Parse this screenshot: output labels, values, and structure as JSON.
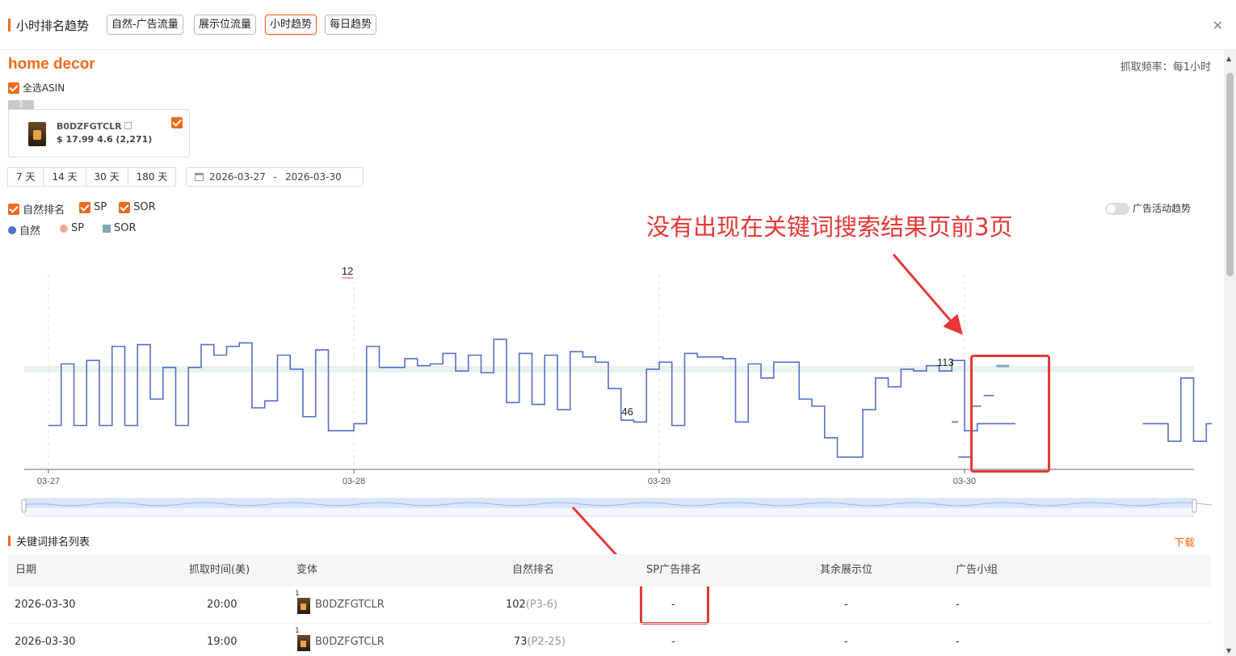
{
  "header": {
    "title": "小时排名趋势",
    "tabs": [
      {
        "label": "自然-广告流量",
        "active": false
      },
      {
        "label": "展示位流量",
        "active": false
      },
      {
        "label": "小时趋势",
        "active": true
      },
      {
        "label": "每日趋势",
        "active": false
      }
    ],
    "close_icon": "close-icon"
  },
  "keyword": "home decor",
  "frequency": "抓取频率：每1小时",
  "select_all_label": "全选ASIN",
  "asin_card": {
    "index": "1",
    "asin": "B0DZFGTCLR",
    "price_rating": "$ 17.99 4.6 (2,271)",
    "checked": true
  },
  "range_buttons": [
    "7 天",
    "14 天",
    "30 天",
    "180 天"
  ],
  "date_range": {
    "start": "2026-03-27",
    "separator": "-",
    "end": "2026-03-30"
  },
  "series_checkboxes": [
    "自然排名",
    "SP",
    "SOR"
  ],
  "legend": [
    {
      "label": "自然",
      "color": "#5470c6",
      "shape": "circle"
    },
    {
      "label": "SP",
      "color": "#f4a89a",
      "shape": "circle"
    },
    {
      "label": "SOR",
      "color": "#7fa8b8",
      "shape": "square"
    }
  ],
  "ad_trend_toggle": {
    "label": "广告活动趋势",
    "on": false
  },
  "annotation_text": "没有出现在关键词搜索结果页前3页",
  "chart_data": {
    "type": "line",
    "step": true,
    "x_ticks": [
      "03-27",
      "03-28",
      "03-29",
      "03-30"
    ],
    "y_inverted": true,
    "y_range": [
      0,
      120
    ],
    "series": [
      {
        "name": "自然",
        "color": "#5470c6",
        "hours": [
          0,
          1,
          2,
          3,
          4,
          5,
          6,
          7,
          8,
          9,
          10,
          11,
          12,
          13,
          14,
          15,
          16,
          17,
          18,
          19,
          20,
          21,
          22,
          23,
          24,
          25,
          26,
          27,
          28,
          29,
          30,
          31,
          32,
          33,
          34,
          35,
          36,
          37,
          38,
          39,
          40,
          41,
          42,
          43,
          44,
          45,
          46,
          47,
          48,
          49,
          50,
          51,
          52,
          53,
          54,
          55,
          56,
          57,
          58,
          59,
          60,
          61,
          62,
          63,
          64,
          65,
          66,
          67,
          68,
          69,
          70,
          71,
          72,
          73,
          74,
          75,
          86,
          87,
          88,
          89,
          90,
          91,
          92,
          93,
          94,
          95
        ],
        "values": [
          95,
          60,
          95,
          58,
          95,
          50,
          95,
          49,
          80,
          62,
          95,
          62,
          49,
          55,
          50,
          48,
          85,
          81,
          55,
          63,
          90,
          52,
          98,
          98,
          94,
          50,
          62,
          62,
          57,
          61,
          60,
          54,
          64,
          55,
          65,
          46,
          82,
          54,
          83,
          55,
          86,
          53,
          56,
          59,
          74,
          92,
          93,
          63,
          59,
          95,
          54,
          56,
          56,
          57,
          93,
          60,
          68,
          59,
          59,
          80,
          84,
          102,
          113,
          113,
          86,
          68,
          73,
          63,
          64,
          61,
          64,
          58,
          98,
          94,
          94,
          94,
          94,
          94,
          104,
          68,
          104,
          94,
          70,
          68,
          68,
          108
        ],
        "gap_after_index": [
          75
        ],
        "segments": [
          {
            "x_hour": 71.0,
            "x_to": 71.5,
            "y": 93
          },
          {
            "x_hour": 71.5,
            "x_to": 72.5,
            "y": 113
          },
          {
            "x_hour": 72.5,
            "x_to": 73.3,
            "y": 84
          },
          {
            "x_hour": 73.5,
            "x_to": 74.3,
            "y": 78
          }
        ],
        "annotations": [
          {
            "label": "46",
            "hour": 45.5
          },
          {
            "label": "113",
            "hour": 70.5
          }
        ]
      },
      {
        "name": "SP",
        "color": "#f4a89a",
        "annotations": [
          {
            "label": "12",
            "hour": 23.5
          }
        ]
      },
      {
        "name": "SOR",
        "color": "#7fa8b8",
        "band_value": 63,
        "mark_hour": 75.0
      }
    ]
  },
  "list": {
    "title": "关键词排名列表",
    "download": "下载",
    "columns": [
      "日期",
      "抓取时间(美)",
      "变体",
      "自然排名",
      "SP广告排名",
      "其余展示位",
      "广告小组"
    ],
    "rows": [
      {
        "date": "2026-03-30",
        "time": "20:00",
        "idx": "1",
        "asin": "B0DZFGTCLR",
        "rank": "102",
        "page": "(P3-6)",
        "sp": "-",
        "other": "-",
        "group": "-"
      },
      {
        "date": "2026-03-30",
        "time": "19:00",
        "idx": "1",
        "asin": "B0DZFGTCLR",
        "rank": "73",
        "page": "(P2-25)",
        "sp": "-",
        "other": "-",
        "group": "-"
      }
    ]
  }
}
